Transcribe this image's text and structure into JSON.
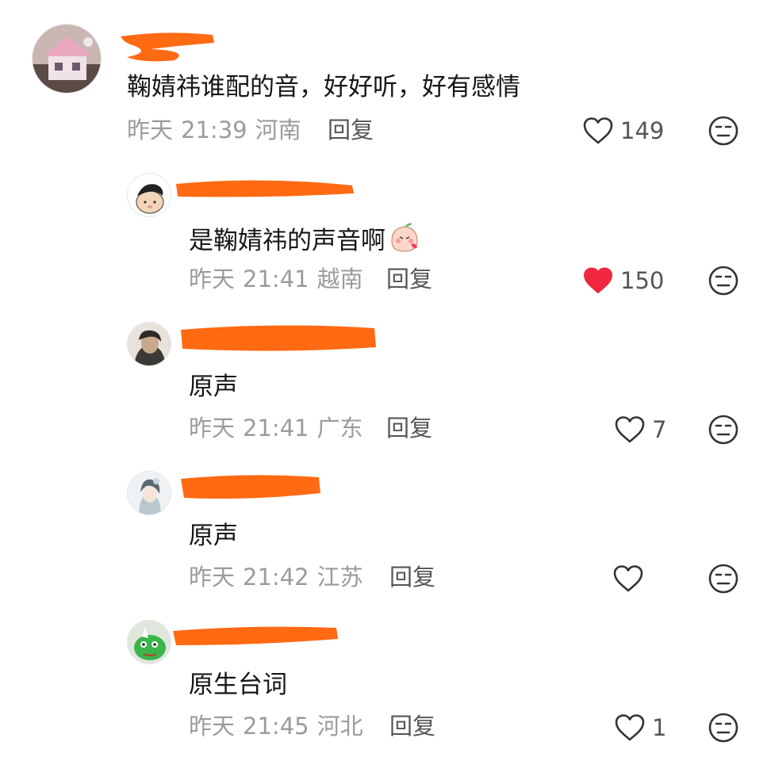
{
  "comments": [
    {
      "text": "鞠婧祎谁配的音，好好听，好有感情",
      "date": "昨天",
      "time": "21:39",
      "region": "河南",
      "reply_label": "回复",
      "likes": "149",
      "liked": false
    },
    {
      "text": "是鞠婧祎的声音啊",
      "date": "昨天",
      "time": "21:41",
      "region": "越南",
      "reply_label": "回复",
      "likes": "150",
      "liked": true
    },
    {
      "text": "原声",
      "date": "昨天",
      "time": "21:41",
      "region": "广东",
      "reply_label": "回复",
      "likes": "7",
      "liked": false
    },
    {
      "text": "原声",
      "date": "昨天",
      "time": "21:42",
      "region": "江苏",
      "reply_label": "回复",
      "likes": "",
      "liked": false
    },
    {
      "text": "原生台词",
      "date": "昨天",
      "time": "21:45",
      "region": "河北",
      "reply_label": "回复",
      "likes": "1",
      "liked": false
    }
  ],
  "colors": {
    "redaction": "#ff6a13",
    "liked_heart": "#f0263f",
    "meta_text": "#9b9b9b",
    "icon_stroke": "#333333"
  },
  "icons": {
    "like": "heart-outline-icon",
    "liked": "heart-filled-icon",
    "dislike": "neutral-face-icon",
    "inline_emoji": "blushing-peach-emoji"
  }
}
